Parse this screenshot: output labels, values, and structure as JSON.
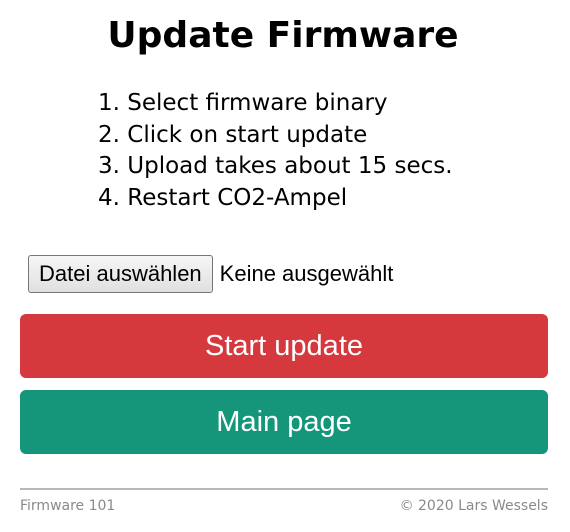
{
  "page": {
    "title": "Update Firmware"
  },
  "instructions": [
    "1. Select firmware binary",
    "2. Click on start update",
    "3. Upload takes about 15 secs.",
    "4. Restart CO2-Ampel"
  ],
  "file_input": {
    "button_label": "Datei auswählen",
    "status": "Keine ausgewählt"
  },
  "buttons": {
    "start_update": "Start update",
    "main_page": "Main page"
  },
  "footer": {
    "version": "Firmware 101",
    "copyright": "© 2020 Lars Wessels"
  },
  "colors": {
    "start_button": "#d5383d",
    "main_button": "#15967a",
    "footer_text": "#8a8a8a",
    "footer_rule": "#b8b8b8"
  }
}
